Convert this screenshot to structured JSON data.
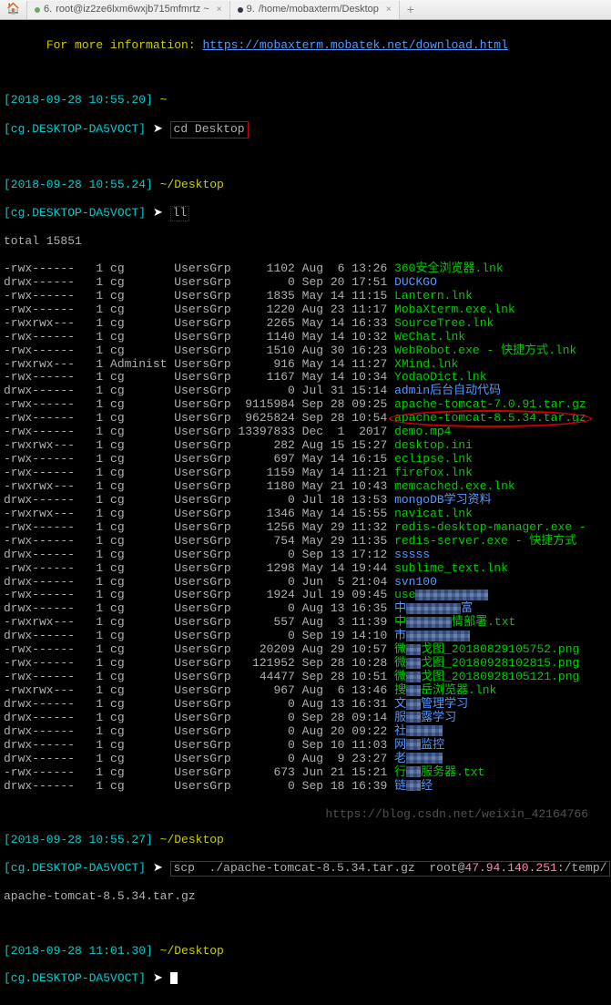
{
  "tabs": {
    "tab1_num": "6.",
    "tab1_label": "root@iz2ze6lxm6wxjb715mfmrtz ~",
    "tab2_num": "9.",
    "tab2_label": "/home/mobaxterm/Desktop",
    "plus": "+"
  },
  "info": {
    "line": "For more information: ",
    "url": "https://mobaxterm.mobatek.net/download.html"
  },
  "prompts": {
    "p1_time": "[2018-09-28 10:55.20]",
    "p1_cwd": "~",
    "p1_host": "[cg.DESKTOP-DA5VOCT]",
    "p1_cmd": "cd Desktop",
    "p2_time": "[2018-09-28 10:55.24]",
    "p2_cwd": "~/Desktop",
    "p2_host": "[cg.DESKTOP-DA5VOCT]",
    "p2_cmd": "ll",
    "p3_time": "[2018-09-28 10:55.27]",
    "p3_cwd": "~/Desktop",
    "p3_host": "[cg.DESKTOP-DA5VOCT]",
    "scp_cmd": "scp  ./apache-tomcat-8.5.34.tar.gz  root@",
    "scp_ip": "47.94.140.251",
    "scp_end": ":/temp/",
    "scp_wrap": "apache-tomcat-8.5.34.tar.gz",
    "p4_time": "[2018-09-28 11:01.30]",
    "p4_cwd": "~/Desktop",
    "p4_host": "[cg.DESKTOP-DA5VOCT]",
    "arrow": " ➤ "
  },
  "total": "total 15851",
  "listing": [
    {
      "perm": "-rwx------",
      "ln": "1",
      "own": "cg",
      "grp": "UsersGrp",
      "size": "1102",
      "date": "Aug  6",
      "time": "13:26",
      "name": "360安全浏览器.lnk",
      "cls": "green"
    },
    {
      "perm": "drwx------",
      "ln": "1",
      "own": "cg",
      "grp": "UsersGrp",
      "size": "0",
      "date": "Sep 20",
      "time": "17:51",
      "name": "DUCKGO",
      "cls": "blue"
    },
    {
      "perm": "-rwx------",
      "ln": "1",
      "own": "cg",
      "grp": "UsersGrp",
      "size": "1835",
      "date": "May 14",
      "time": "11:15",
      "name": "Lantern.lnk",
      "cls": "green"
    },
    {
      "perm": "-rwx------",
      "ln": "1",
      "own": "cg",
      "grp": "UsersGrp",
      "size": "1220",
      "date": "Aug 23",
      "time": "11:17",
      "name": "MobaXterm.exe.lnk",
      "cls": "green"
    },
    {
      "perm": "-rwxrwx---",
      "ln": "1",
      "own": "cg",
      "grp": "UsersGrp",
      "size": "2265",
      "date": "May 14",
      "time": "16:33",
      "name": "SourceTree.lnk",
      "cls": "green"
    },
    {
      "perm": "-rwx------",
      "ln": "1",
      "own": "cg",
      "grp": "UsersGrp",
      "size": "1140",
      "date": "May 14",
      "time": "10:32",
      "name": "WeChat.lnk",
      "cls": "green"
    },
    {
      "perm": "-rwx------",
      "ln": "1",
      "own": "cg",
      "grp": "UsersGrp",
      "size": "1510",
      "date": "Aug 30",
      "time": "16:23",
      "name": "WebRobot.exe - 快捷方式.lnk",
      "cls": "green"
    },
    {
      "perm": "-rwxrwx---",
      "ln": "1",
      "own": "Administ",
      "grp": "UsersGrp",
      "size": "916",
      "date": "May 14",
      "time": "11:27",
      "name": "XMind.lnk",
      "cls": "green"
    },
    {
      "perm": "-rwx------",
      "ln": "1",
      "own": "cg",
      "grp": "UsersGrp",
      "size": "1167",
      "date": "May 14",
      "time": "10:34",
      "name": "YodaoDict.lnk",
      "cls": "green"
    },
    {
      "perm": "drwx------",
      "ln": "1",
      "own": "cg",
      "grp": "UsersGrp",
      "size": "0",
      "date": "Jul 31",
      "time": "15:14",
      "name": "admin后台自动代码",
      "cls": "blue"
    },
    {
      "perm": "-rwx------",
      "ln": "1",
      "own": "cg",
      "grp": "UsersGrp",
      "size": "9115984",
      "date": "Sep 28",
      "time": "09:25",
      "name": "apache-tomcat-7.0.91.tar.gz",
      "cls": "green"
    },
    {
      "perm": "-rwx------",
      "ln": "1",
      "own": "cg",
      "grp": "UsersGrp",
      "size": "9625824",
      "date": "Sep 28",
      "time": "10:54",
      "name": "apache-tomcat-8.5.34.tar.gz",
      "cls": "ellipse"
    },
    {
      "perm": "-rwx------",
      "ln": "1",
      "own": "cg",
      "grp": "UsersGrp",
      "size": "13397833",
      "date": "Dec  1",
      "time": " 2017",
      "name": "demo.mp4",
      "cls": "green"
    },
    {
      "perm": "-rwxrwx---",
      "ln": "1",
      "own": "cg",
      "grp": "UsersGrp",
      "size": "282",
      "date": "Aug 15",
      "time": "15:27",
      "name": "desktop.ini",
      "cls": "green"
    },
    {
      "perm": "-rwx------",
      "ln": "1",
      "own": "cg",
      "grp": "UsersGrp",
      "size": "697",
      "date": "May 14",
      "time": "16:15",
      "name": "eclipse.lnk",
      "cls": "green"
    },
    {
      "perm": "-rwx------",
      "ln": "1",
      "own": "cg",
      "grp": "UsersGrp",
      "size": "1159",
      "date": "May 14",
      "time": "11:21",
      "name": "firefox.lnk",
      "cls": "green"
    },
    {
      "perm": "-rwxrwx---",
      "ln": "1",
      "own": "cg",
      "grp": "UsersGrp",
      "size": "1180",
      "date": "May 21",
      "time": "10:43",
      "name": "memcached.exe.lnk",
      "cls": "green"
    },
    {
      "perm": "drwx------",
      "ln": "1",
      "own": "cg",
      "grp": "UsersGrp",
      "size": "0",
      "date": "Jul 18",
      "time": "13:53",
      "name": "mongoDB学习资料",
      "cls": "blue"
    },
    {
      "perm": "-rwxrwx---",
      "ln": "1",
      "own": "cg",
      "grp": "UsersGrp",
      "size": "1346",
      "date": "May 14",
      "time": "15:55",
      "name": "navicat.lnk",
      "cls": "green"
    },
    {
      "perm": "-rwx------",
      "ln": "1",
      "own": "cg",
      "grp": "UsersGrp",
      "size": "1256",
      "date": "May 29",
      "time": "11:32",
      "name": "redis-desktop-manager.exe -",
      "cls": "green"
    },
    {
      "perm": "-rwx------",
      "ln": "1",
      "own": "cg",
      "grp": "UsersGrp",
      "size": "754",
      "date": "May 29",
      "time": "11:35",
      "name": "redis-server.exe - 快捷方式",
      "cls": "green"
    },
    {
      "perm": "drwx------",
      "ln": "1",
      "own": "cg",
      "grp": "UsersGrp",
      "size": "0",
      "date": "Sep 13",
      "time": "17:12",
      "name": "sssss",
      "cls": "blue"
    },
    {
      "perm": "-rwx------",
      "ln": "1",
      "own": "cg",
      "grp": "UsersGrp",
      "size": "1298",
      "date": "May 14",
      "time": "19:44",
      "name": "sublime_text.lnk",
      "cls": "green"
    },
    {
      "perm": "drwx------",
      "ln": "1",
      "own": "cg",
      "grp": "UsersGrp",
      "size": "0",
      "date": "Jun  5",
      "time": "21:04",
      "name": "svn100",
      "cls": "blue"
    },
    {
      "perm": "-rwx------",
      "ln": "1",
      "own": "cg",
      "grp": "UsersGrp",
      "size": "1924",
      "date": "Jul 19",
      "time": "09:45",
      "name": "use",
      "cls": "green",
      "pix": 80
    },
    {
      "perm": "drwx------",
      "ln": "1",
      "own": "cg",
      "grp": "UsersGrp",
      "size": "0",
      "date": "Aug 13",
      "time": "16:35",
      "name": "中",
      "cls": "blue",
      "pix": 60,
      "suf": "富"
    },
    {
      "perm": "-rwxrwx---",
      "ln": "1",
      "own": "cg",
      "grp": "UsersGrp",
      "size": "557",
      "date": "Aug  3",
      "time": "11:39",
      "name": "中",
      "cls": "green",
      "pix": 50,
      "suf": "情部署.txt"
    },
    {
      "perm": "drwx------",
      "ln": "1",
      "own": "cg",
      "grp": "UsersGrp",
      "size": "0",
      "date": "Sep 19",
      "time": "14:10",
      "name": "市",
      "cls": "blue",
      "pix": 70
    },
    {
      "perm": "-rwx------",
      "ln": "1",
      "own": "cg",
      "grp": "UsersGrp",
      "size": "20209",
      "date": "Aug 29",
      "time": "10:57",
      "name": "微",
      "cls": "green",
      "pix": 16,
      "suf": "戈图_20180829105752.png"
    },
    {
      "perm": "-rwx------",
      "ln": "1",
      "own": "cg",
      "grp": "UsersGrp",
      "size": "121952",
      "date": "Sep 28",
      "time": "10:28",
      "name": "微",
      "cls": "green",
      "pix": 16,
      "suf": "戈图_20180928102815.png"
    },
    {
      "perm": "-rwx------",
      "ln": "1",
      "own": "cg",
      "grp": "UsersGrp",
      "size": "44477",
      "date": "Sep 28",
      "time": "10:51",
      "name": "微",
      "cls": "green",
      "pix": 16,
      "suf": "戈图_20180928105121.png"
    },
    {
      "perm": "-rwxrwx---",
      "ln": "1",
      "own": "cg",
      "grp": "UsersGrp",
      "size": "967",
      "date": "Aug  6",
      "time": "13:46",
      "name": "搜",
      "cls": "green",
      "pix": 16,
      "suf": "岳浏览器.lnk"
    },
    {
      "perm": "drwx------",
      "ln": "1",
      "own": "cg",
      "grp": "UsersGrp",
      "size": "0",
      "date": "Aug 13",
      "time": "16:31",
      "name": "文",
      "cls": "blue",
      "pix": 16,
      "suf": "管理学习"
    },
    {
      "perm": "drwx------",
      "ln": "1",
      "own": "cg",
      "grp": "UsersGrp",
      "size": "0",
      "date": "Sep 28",
      "time": "09:14",
      "name": "服",
      "cls": "blue",
      "pix": 16,
      "suf": "露学习"
    },
    {
      "perm": "drwx------",
      "ln": "1",
      "own": "cg",
      "grp": "UsersGrp",
      "size": "0",
      "date": "Aug 20",
      "time": "09:22",
      "name": "社",
      "cls": "blue",
      "pix": 40
    },
    {
      "perm": "drwx------",
      "ln": "1",
      "own": "cg",
      "grp": "UsersGrp",
      "size": "0",
      "date": "Sep 10",
      "time": "11:03",
      "name": "网",
      "cls": "blue",
      "pix": 16,
      "suf": "监控"
    },
    {
      "perm": "drwx------",
      "ln": "1",
      "own": "cg",
      "grp": "UsersGrp",
      "size": "0",
      "date": "Aug  9",
      "time": "23:27",
      "name": "老",
      "cls": "blue",
      "pix": 40
    },
    {
      "perm": "-rwx------",
      "ln": "1",
      "own": "cg",
      "grp": "UsersGrp",
      "size": "673",
      "date": "Jun 21",
      "time": "15:21",
      "name": "行",
      "cls": "green",
      "pix": 16,
      "suf": "服务器.txt"
    },
    {
      "perm": "drwx------",
      "ln": "1",
      "own": "cg",
      "grp": "UsersGrp",
      "size": "0",
      "date": "Sep 18",
      "time": "16:39",
      "name": "链",
      "cls": "blue",
      "pix": 16,
      "suf": "经"
    }
  ],
  "watermark": "https://blog.csdn.net/weixin_42164766"
}
